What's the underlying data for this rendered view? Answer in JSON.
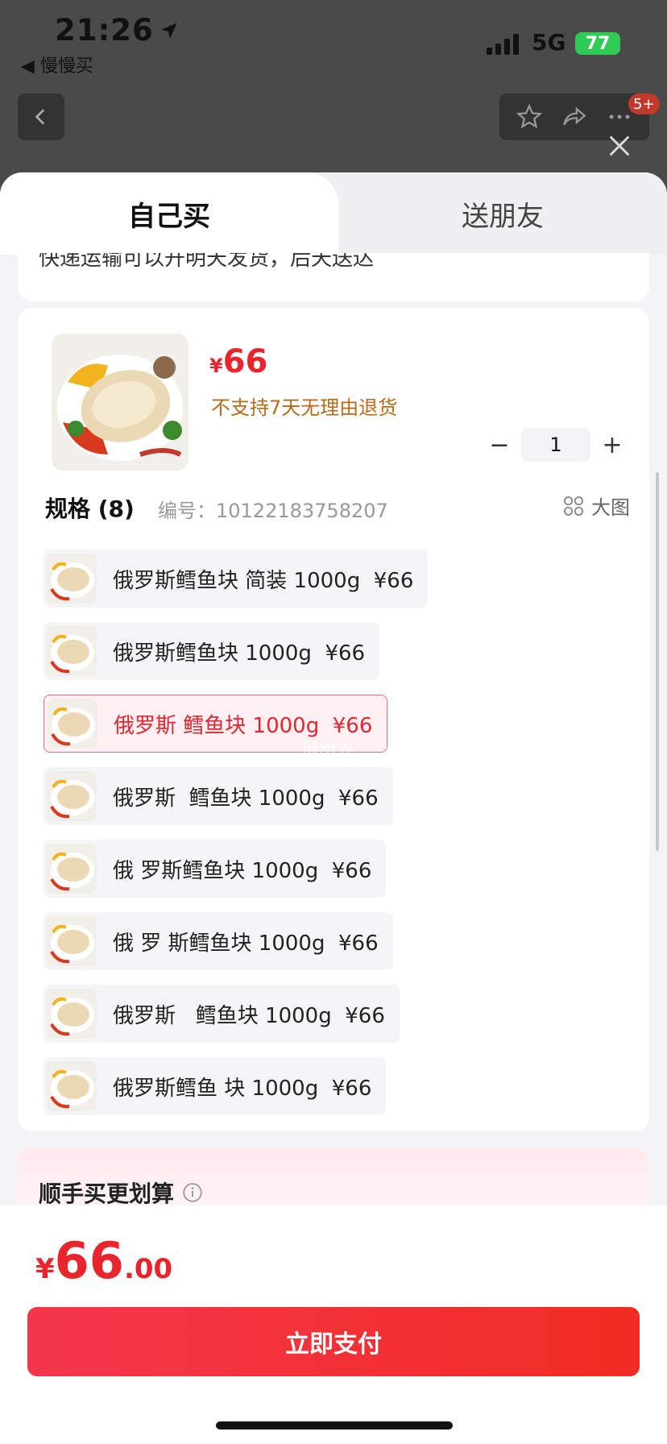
{
  "status_bar": {
    "time": "21:26",
    "back_app_label": "◀ 慢慢买",
    "network": "5G",
    "battery": "77"
  },
  "nav": {
    "badge": "5+"
  },
  "sheet": {
    "tabs": [
      {
        "label": "自己买",
        "active": true
      },
      {
        "label": "送朋友",
        "active": false
      }
    ],
    "previous_card_text": "快递运输可以开明天发货，后天送达",
    "product": {
      "currency": "¥",
      "price": "66",
      "policy": "不支持7天无理由退货",
      "quantity": "1",
      "minus": "−",
      "plus": "+"
    },
    "spec": {
      "title": "规格 (8)",
      "code_label": "编号：10122183758207",
      "big_picture": "大图"
    },
    "options": [
      {
        "label": "俄罗斯鳕鱼块 简装 1000g  ¥66",
        "selected": false
      },
      {
        "label": "俄罗斯鳕鱼块 1000g  ¥66",
        "selected": false
      },
      {
        "label": "俄罗斯 鳕鱼块 1000g  ¥66",
        "selected": true
      },
      {
        "label": "俄罗斯  鳕鱼块 1000g  ¥66",
        "selected": false
      },
      {
        "label": "俄 罗斯鳕鱼块 1000g  ¥66",
        "selected": false
      },
      {
        "label": "俄 罗 斯鳕鱼块 1000g  ¥66",
        "selected": false
      },
      {
        "label": "俄罗斯   鳕鱼块 1000g  ¥66",
        "selected": false
      },
      {
        "label": "俄罗斯鳕鱼 块 1000g  ¥66",
        "selected": false
      }
    ],
    "watermark": "爆串光",
    "addon_title": "顺手买更划算"
  },
  "footer": {
    "currency": "¥",
    "total_int": "66",
    "total_dec": ".00",
    "pay_label": "立即支付"
  },
  "colors": {
    "accent": "#e8242d",
    "policy": "#b86a1a",
    "selected_border": "#f16b86"
  }
}
